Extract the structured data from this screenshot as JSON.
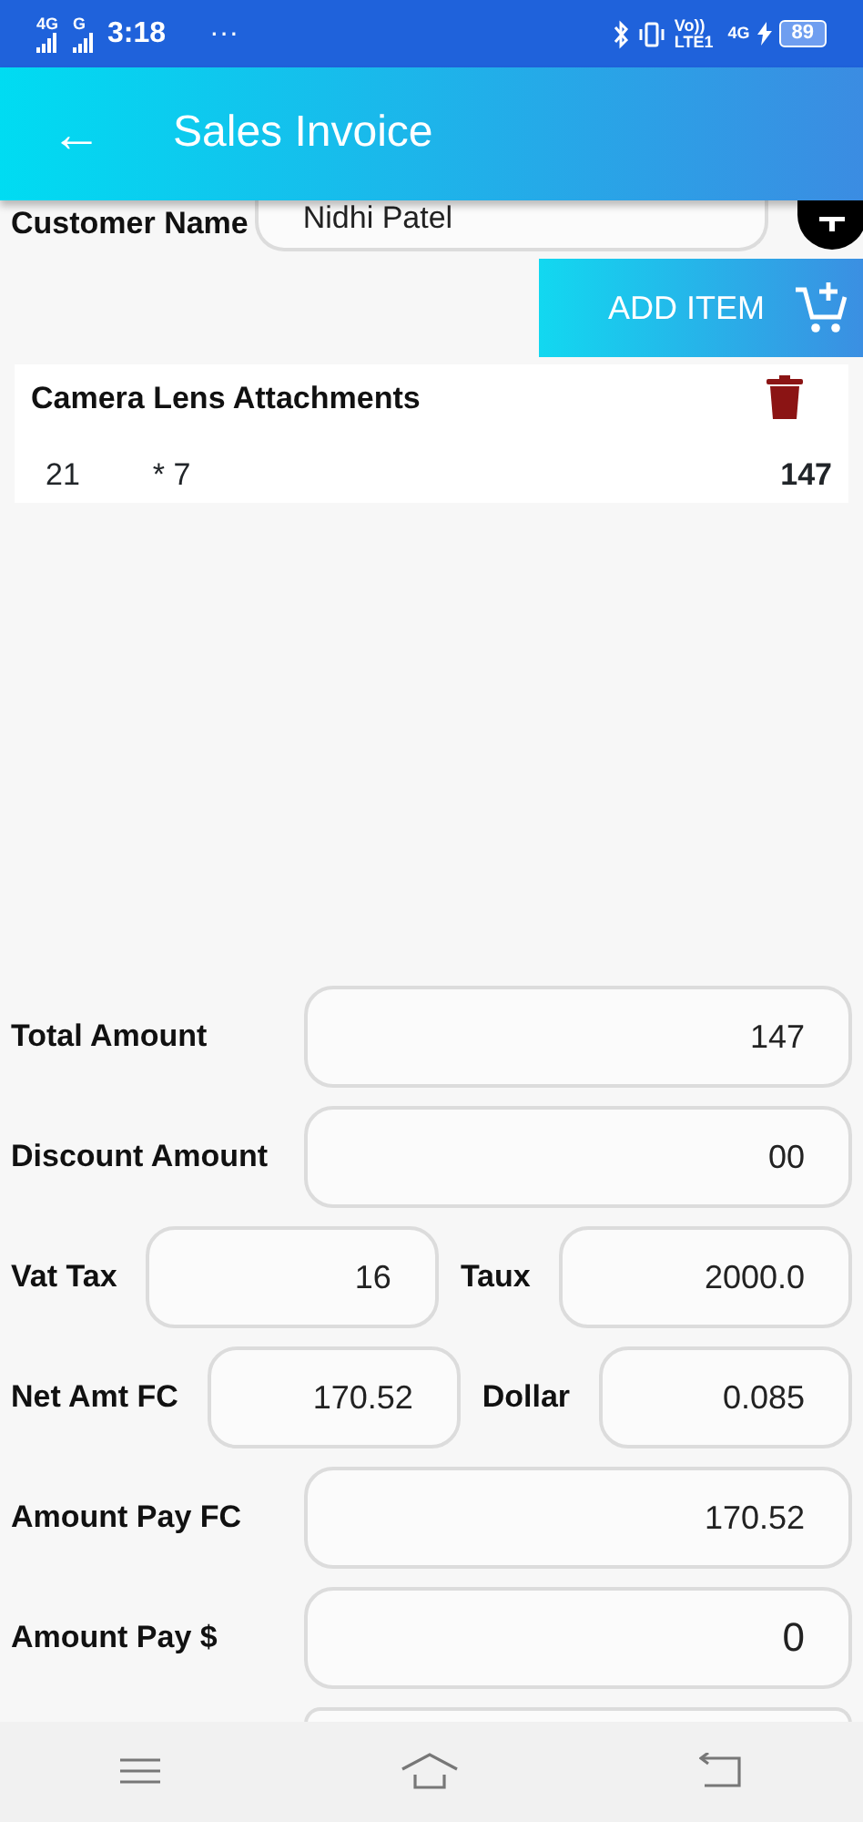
{
  "status_bar": {
    "left_labels": [
      "4G",
      "G"
    ],
    "time": "3:18",
    "more": "···",
    "right_labels": [
      "Vo))",
      "LTE1",
      "4G"
    ],
    "battery": "89"
  },
  "app_bar": {
    "back": "←",
    "title": "Sales Invoice"
  },
  "customer": {
    "label": "Customer Name",
    "value": "Nidhi Patel"
  },
  "add_item": {
    "label": "ADD ITEM"
  },
  "items": [
    {
      "name": "Camera Lens Attachments",
      "quantity": "21",
      "rate": "* 7",
      "total": "147"
    }
  ],
  "summary_rows": [
    {
      "kind": "wide",
      "fields": [
        {
          "label": "Total Amount",
          "value": "147"
        }
      ]
    },
    {
      "kind": "wide",
      "fields": [
        {
          "label": "Discount Amount",
          "value": "00"
        }
      ]
    },
    {
      "kind": "pair",
      "fields": [
        {
          "label": "Vat Tax",
          "value": "16"
        },
        {
          "label": "Taux",
          "value": "2000.0"
        }
      ]
    },
    {
      "kind": "pair",
      "fields": [
        {
          "label": "Net Amt FC",
          "value": "170.52"
        },
        {
          "label": "Dollar",
          "value": "0.085"
        }
      ]
    },
    {
      "kind": "wide",
      "fields": [
        {
          "label": "Amount Pay FC",
          "value": "170.52"
        }
      ]
    },
    {
      "kind": "wide_large",
      "fields": [
        {
          "label": "Amount Pay $",
          "value": "0"
        }
      ]
    },
    {
      "kind": "partial"
    }
  ]
}
